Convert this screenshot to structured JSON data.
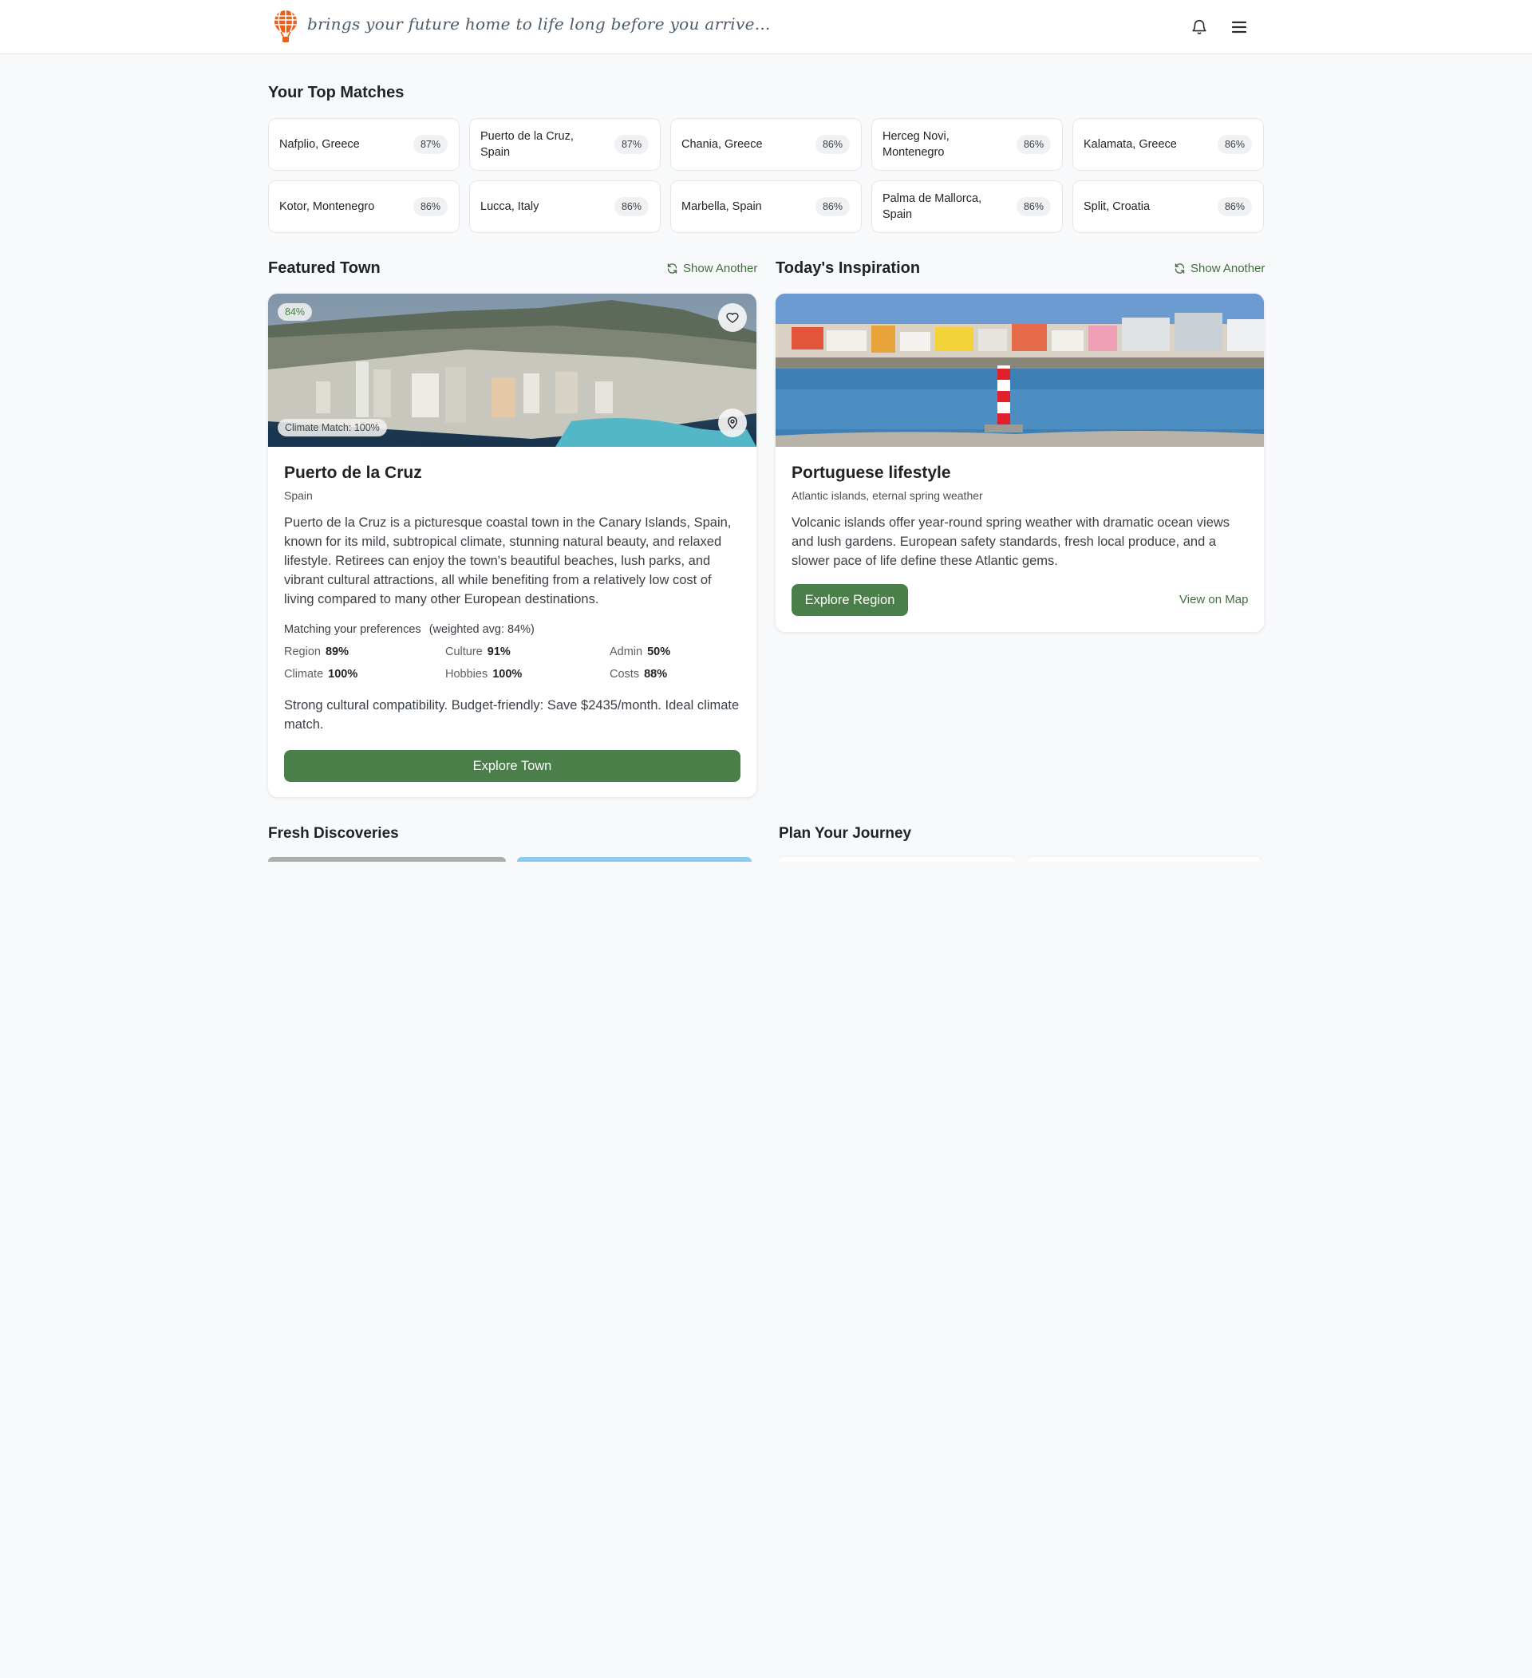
{
  "header": {
    "tagline": "brings your future home to life long before you arrive...",
    "logo_icon": "hot-air-balloon-icon",
    "notification_icon": "bell-icon",
    "menu_icon": "hamburger-menu-icon"
  },
  "colors": {
    "accent": "#4a7f4a",
    "link": "#3f6f3a",
    "logo": "#e8601c",
    "background": "#f8f9fb"
  },
  "top_matches": {
    "title": "Your Top Matches",
    "items": [
      {
        "name": "Nafplio, Greece",
        "pct": "87%"
      },
      {
        "name": "Puerto de la Cruz, Spain",
        "pct": "87%"
      },
      {
        "name": "Chania, Greece",
        "pct": "86%"
      },
      {
        "name": "Herceg Novi, Montenegro",
        "pct": "86%"
      },
      {
        "name": "Kalamata, Greece",
        "pct": "86%"
      },
      {
        "name": "Kotor, Montenegro",
        "pct": "86%"
      },
      {
        "name": "Lucca, Italy",
        "pct": "86%"
      },
      {
        "name": "Marbella, Spain",
        "pct": "86%"
      },
      {
        "name": "Palma de Mallorca, Spain",
        "pct": "86%"
      },
      {
        "name": "Split, Croatia",
        "pct": "86%"
      }
    ]
  },
  "featured": {
    "title": "Featured Town",
    "show_another": "Show Another",
    "match_badge": "84%",
    "climate_badge": "Climate Match: 100%",
    "town": "Puerto de la Cruz",
    "country": "Spain",
    "description": "Puerto de la Cruz is a picturesque coastal town in the Canary Islands, Spain, known for its mild, subtropical climate, stunning natural beauty, and relaxed lifestyle. Retirees can enjoy the town's beautiful beaches, lush parks, and vibrant cultural attractions, all while benefiting from a relatively low cost of living compared to many other European destinations.",
    "prefs_label": "Matching your preferences",
    "prefs_avg": "(weighted avg: 84%)",
    "prefs": [
      {
        "key": "Region",
        "value": "89%"
      },
      {
        "key": "Culture",
        "value": "91%"
      },
      {
        "key": "Admin",
        "value": "50%"
      },
      {
        "key": "Climate",
        "value": "100%"
      },
      {
        "key": "Hobbies",
        "value": "100%"
      },
      {
        "key": "Costs",
        "value": "88%"
      }
    ],
    "summary": "Strong cultural compatibility. Budget-friendly: Save $2435/month. Ideal climate match.",
    "button": "Explore Town"
  },
  "inspiration": {
    "title": "Today's Inspiration",
    "show_another": "Show Another",
    "heading": "Portuguese lifestyle",
    "subtitle": "Atlantic islands, eternal spring weather",
    "description": "Volcanic islands offer year-round spring weather with dramatic ocean views and lush gardens. European safety standards, fresh local produce, and a slower pace of life define these Atlantic gems.",
    "button": "Explore Region",
    "map_link": "View on Map"
  },
  "fresh": {
    "title": "Fresh Discoveries"
  },
  "journey": {
    "title": "Plan Your Journey"
  }
}
